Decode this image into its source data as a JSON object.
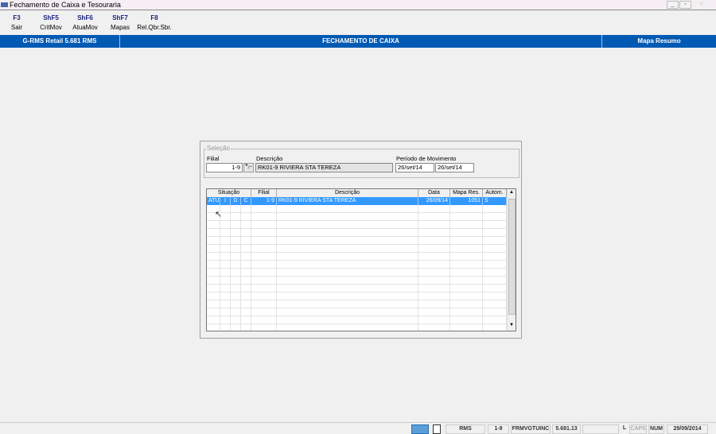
{
  "window": {
    "title": "Fechamento de Caixa e Tesouraria",
    "controls": [
      "_",
      "▫",
      "✕"
    ]
  },
  "toolbar": [
    {
      "key": "F3",
      "label": "Sair"
    },
    {
      "key": "ShF5",
      "label": "CritMov"
    },
    {
      "key": "ShF6",
      "label": "AtuaMov"
    },
    {
      "key": "ShF7",
      "label": "Mapas"
    },
    {
      "key": "F8",
      "label": "Rel.Qbr.Sbr."
    }
  ],
  "band": {
    "left": "G-RMS Retail 5.681 RMS",
    "center": "FECHAMENTO DE CAIXA",
    "right": "Mapa Resumo",
    "color": "#0059b3"
  },
  "selection": {
    "group_label": "Seleção",
    "filial_label": "Filial",
    "filial_value": "1-9",
    "descricao_label": "Descrição",
    "descricao_value": "RK01-9 RIVIERA STA TEREZA",
    "periodo_label": "Período de Movimento",
    "periodo_from": "26/set/14",
    "periodo_to": "26/set/14"
  },
  "grid": {
    "headers": {
      "situacao": "Situação",
      "filial": "Filial",
      "descricao": "Descrição",
      "data": "Data",
      "mapa": "Mapa Res.",
      "autom": "Autom."
    },
    "rows": [
      {
        "s1": "ATU",
        "s2": "I",
        "s3": "D",
        "s4": "C",
        "filial": "1-9",
        "descricao": "RK01-9 RIVIERA STA TEREZA",
        "data": "26/09/14",
        "mapa": "1051",
        "autom": "S"
      }
    ]
  },
  "statusbar": {
    "system": "RMS",
    "filial": "1-9",
    "form": "FRMVGTUINC",
    "version": "5.681.13",
    "l": "L",
    "caps": "CAPS",
    "num": "NUM",
    "date": "29/09/2014"
  }
}
